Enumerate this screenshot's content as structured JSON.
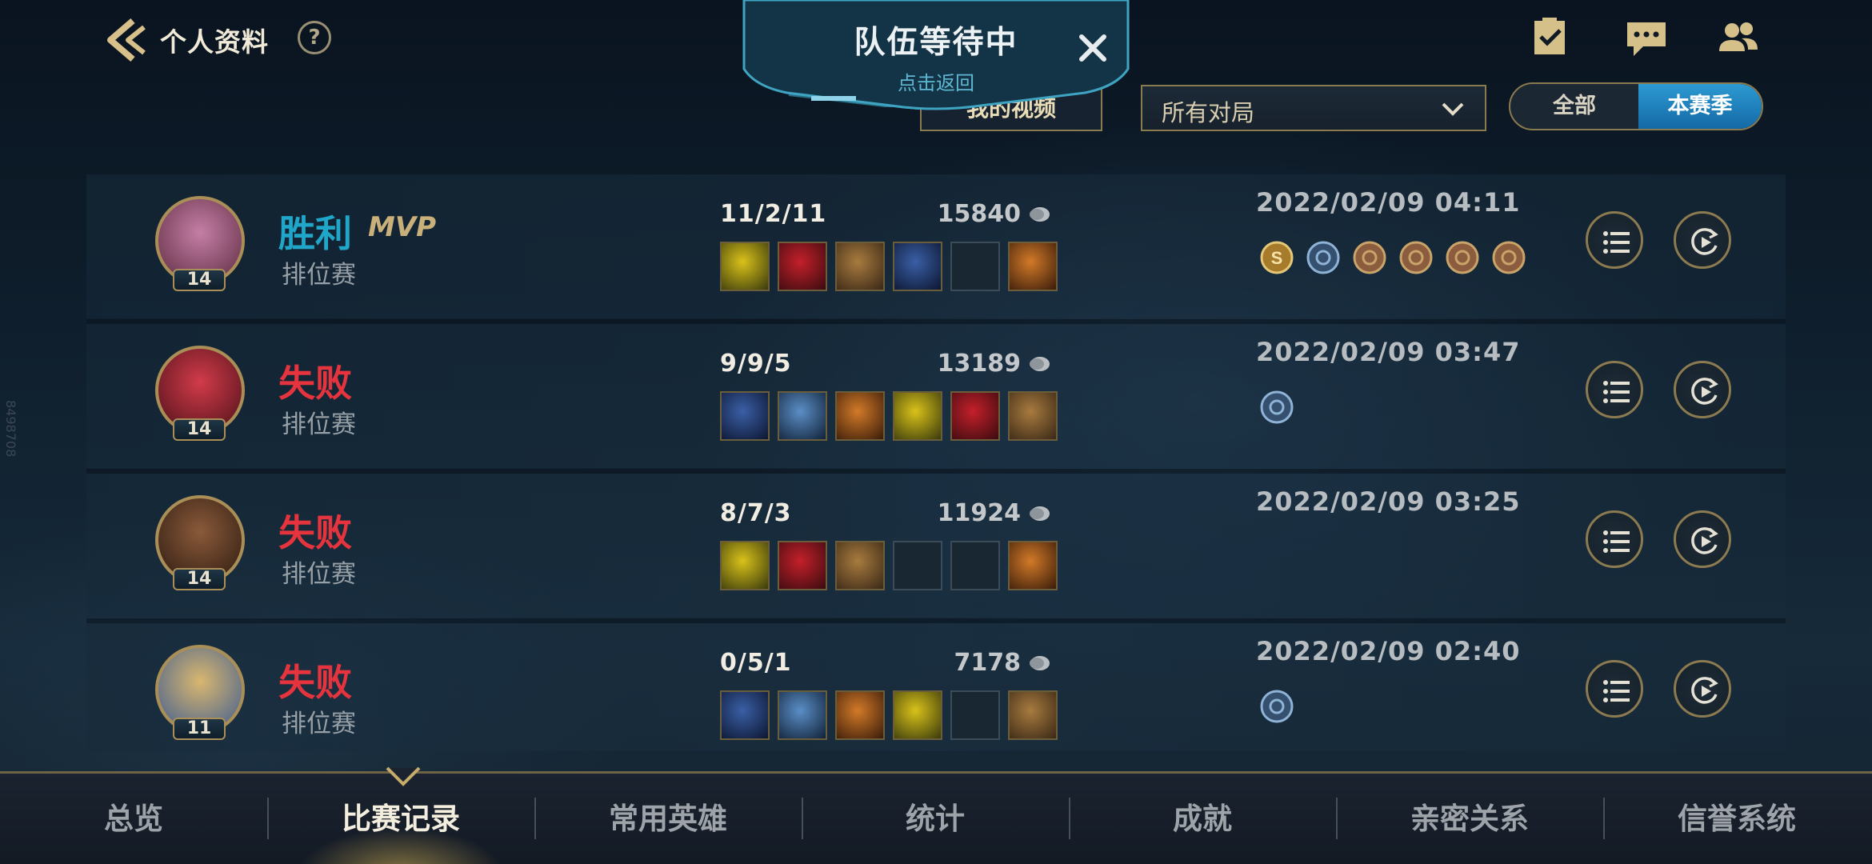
{
  "header": {
    "title": "个人资料",
    "help_label": "?"
  },
  "queue": {
    "title": "队伍等待中",
    "subtitle": "点击返回"
  },
  "filters": {
    "video_label": "我的视频",
    "select_value": "所有对局",
    "toggle_all": "全部",
    "toggle_season": "本赛季"
  },
  "colors": {
    "win": "#1fa6c9",
    "loss": "#e5343d",
    "accent_gold": "#a98f57",
    "active_toggle": "#1f86c0"
  },
  "matches": [
    {
      "level": "14",
      "result": "胜利",
      "result_type": "win",
      "mvp": "MVP",
      "mode": "排位赛",
      "kda": "11/2/11",
      "gold": "15840",
      "items": [
        "sword-icon",
        "crimson-blade-icon",
        "golden-gauntlet-icon",
        "arcane-blade-icon",
        "empty-slot",
        "blue-ward-totem-icon"
      ],
      "date": "2022/02/09 04:11",
      "badges": [
        "s-rank-badge-icon",
        "sword-cross-badge-icon",
        "flower-badge-icon",
        "ring-badge-icon",
        "swirl-badge-icon",
        "drop-badge-icon"
      ]
    },
    {
      "level": "14",
      "result": "失败",
      "result_type": "loss",
      "mvp": "",
      "mode": "排位赛",
      "kda": "9/9/5",
      "gold": "13189",
      "items": [
        "rune-orb-icon",
        "void-hat-icon",
        "purple-staff-icon",
        "spellbook-icon",
        "gold-scythe-icon",
        "fire-totem-icon"
      ],
      "date": "2022/02/09 03:47",
      "badges": [
        "shield-badge-icon"
      ]
    },
    {
      "level": "14",
      "result": "失败",
      "result_type": "loss",
      "mvp": "",
      "mode": "排位赛",
      "kda": "8/7/3",
      "gold": "11924",
      "items": [
        "dark-blade-icon",
        "fire-orb-icon",
        "winged-staff-icon",
        "empty-slot",
        "empty-slot",
        "golden-totem-icon"
      ],
      "date": "2022/02/09 03:25",
      "badges": []
    },
    {
      "level": "11",
      "result": "失败",
      "result_type": "loss",
      "mvp": "",
      "mode": "排位赛",
      "kda": "0/5/1",
      "gold": "7178",
      "items": [
        "ice-spear-icon",
        "frost-gauntlet-icon",
        "twin-daggers-icon",
        "teal-dagger-icon",
        "empty-slot",
        "leather-boots-icon"
      ],
      "date": "2022/02/09 02:40",
      "badges": [
        "flame-badge-icon"
      ]
    }
  ],
  "nav": {
    "items": [
      "总览",
      "比赛记录",
      "常用英雄",
      "统计",
      "成就",
      "亲密关系",
      "信誉系统"
    ],
    "active_index": 1
  },
  "watermark": "8498708"
}
